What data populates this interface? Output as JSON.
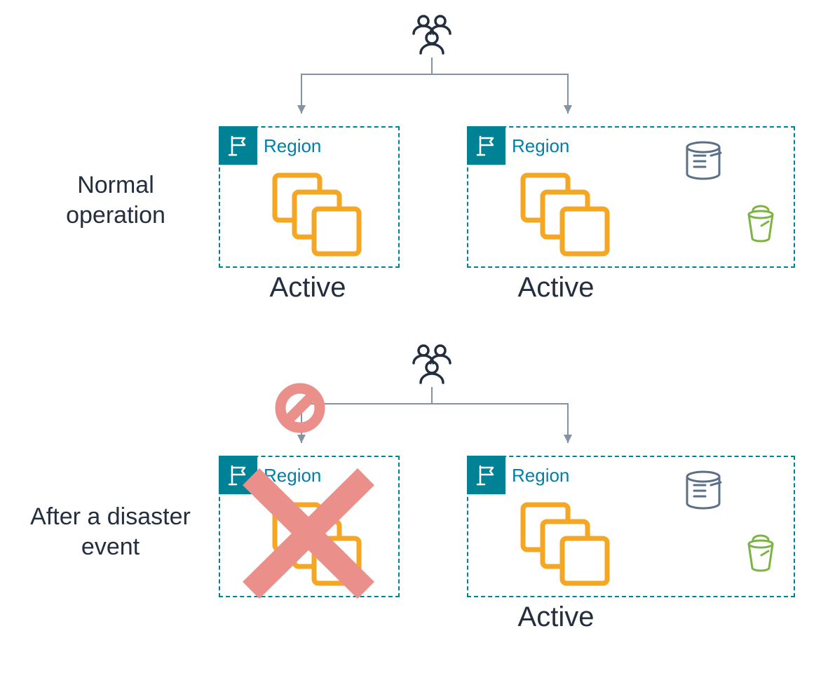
{
  "labels": {
    "normal": "Normal operation",
    "disaster": "After a disaster event",
    "active": "Active",
    "region": "Region"
  },
  "colors": {
    "dark": "#232f3e",
    "teal": "#008296",
    "tealText": "#007faa",
    "orange": "#f5a623",
    "arrow": "#8592a3",
    "coral": "#e57373",
    "dbBlue": "#5b6f87",
    "bucketGreen": "#8bc34a"
  }
}
